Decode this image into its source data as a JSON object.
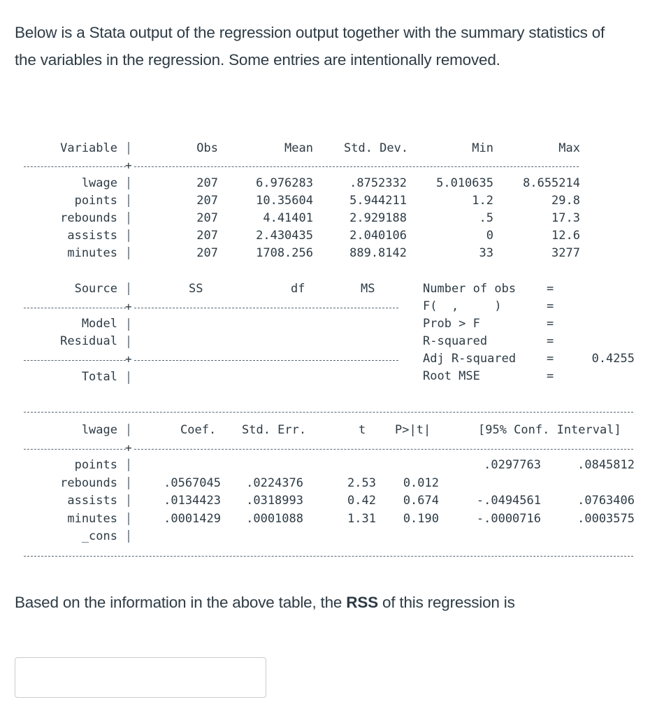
{
  "intro_text": "Below is a Stata output of the regression output together with the summary statistics of the variables in the regression. Some entries are intentionally removed.",
  "summary_table": {
    "headers": [
      "Variable",
      "Obs",
      "Mean",
      "Std. Dev.",
      "Min",
      "Max"
    ],
    "rows": [
      {
        "variable": "lwage",
        "obs": "207",
        "mean": "6.976283",
        "sd": ".8752332",
        "min": "5.010635",
        "max": "8.655214"
      },
      {
        "variable": "points",
        "obs": "207",
        "mean": "10.35604",
        "sd": "5.944211",
        "min": "1.2",
        "max": "29.8"
      },
      {
        "variable": "rebounds",
        "obs": "207",
        "mean": "4.41401",
        "sd": "2.929188",
        "min": ".5",
        "max": "17.3"
      },
      {
        "variable": "assists",
        "obs": "207",
        "mean": "2.430435",
        "sd": "2.040106",
        "min": "0",
        "max": "12.6"
      },
      {
        "variable": "minutes",
        "obs": "207",
        "mean": "1708.256",
        "sd": "889.8142",
        "min": "33",
        "max": "3277"
      }
    ]
  },
  "anova_table": {
    "headers": [
      "Source",
      "SS",
      "df",
      "MS"
    ],
    "rows": [
      {
        "source": "Model",
        "ss": "",
        "df": "",
        "ms": ""
      },
      {
        "source": "Residual",
        "ss": "",
        "df": "",
        "ms": ""
      },
      {
        "source": "Total",
        "ss": "",
        "df": "",
        "ms": ""
      }
    ],
    "stats": [
      {
        "label": "Number of obs",
        "eq": "=",
        "value": ""
      },
      {
        "label": "F(  ,     )",
        "eq": "=",
        "value": ""
      },
      {
        "label": "Prob > F",
        "eq": "=",
        "value": ""
      },
      {
        "label": "R-squared",
        "eq": "=",
        "value": ""
      },
      {
        "label": "Adj R-squared",
        "eq": "=",
        "value": "0.4255"
      },
      {
        "label": "Root MSE",
        "eq": "=",
        "value": ""
      }
    ]
  },
  "coef_table": {
    "depvar": "lwage",
    "headers": [
      "Coef.",
      "Std. Err.",
      "t",
      "P>|t|",
      "[95% Conf. Interval]"
    ],
    "rows": [
      {
        "variable": "points",
        "coef": "",
        "se": "",
        "t": "",
        "p": "",
        "ci_low": ".0297763",
        "ci_high": ".0845812"
      },
      {
        "variable": "rebounds",
        "coef": ".0567045",
        "se": ".0224376",
        "t": "2.53",
        "p": "0.012",
        "ci_low": "",
        "ci_high": ""
      },
      {
        "variable": "assists",
        "coef": ".0134423",
        "se": ".0318993",
        "t": "0.42",
        "p": "0.674",
        "ci_low": "-.0494561",
        "ci_high": ".0763406"
      },
      {
        "variable": "minutes",
        "coef": ".0001429",
        "se": ".0001088",
        "t": "1.31",
        "p": "0.190",
        "ci_low": "-.0000716",
        "ci_high": ".0003575"
      },
      {
        "variable": "_cons",
        "coef": "",
        "se": "",
        "t": "",
        "p": "",
        "ci_low": "",
        "ci_high": ""
      }
    ]
  },
  "question": {
    "prefix": "Based on the information in the above table, the ",
    "bold": "RSS",
    "suffix": " of this regression is"
  },
  "answer": {
    "value": "",
    "placeholder": ""
  }
}
